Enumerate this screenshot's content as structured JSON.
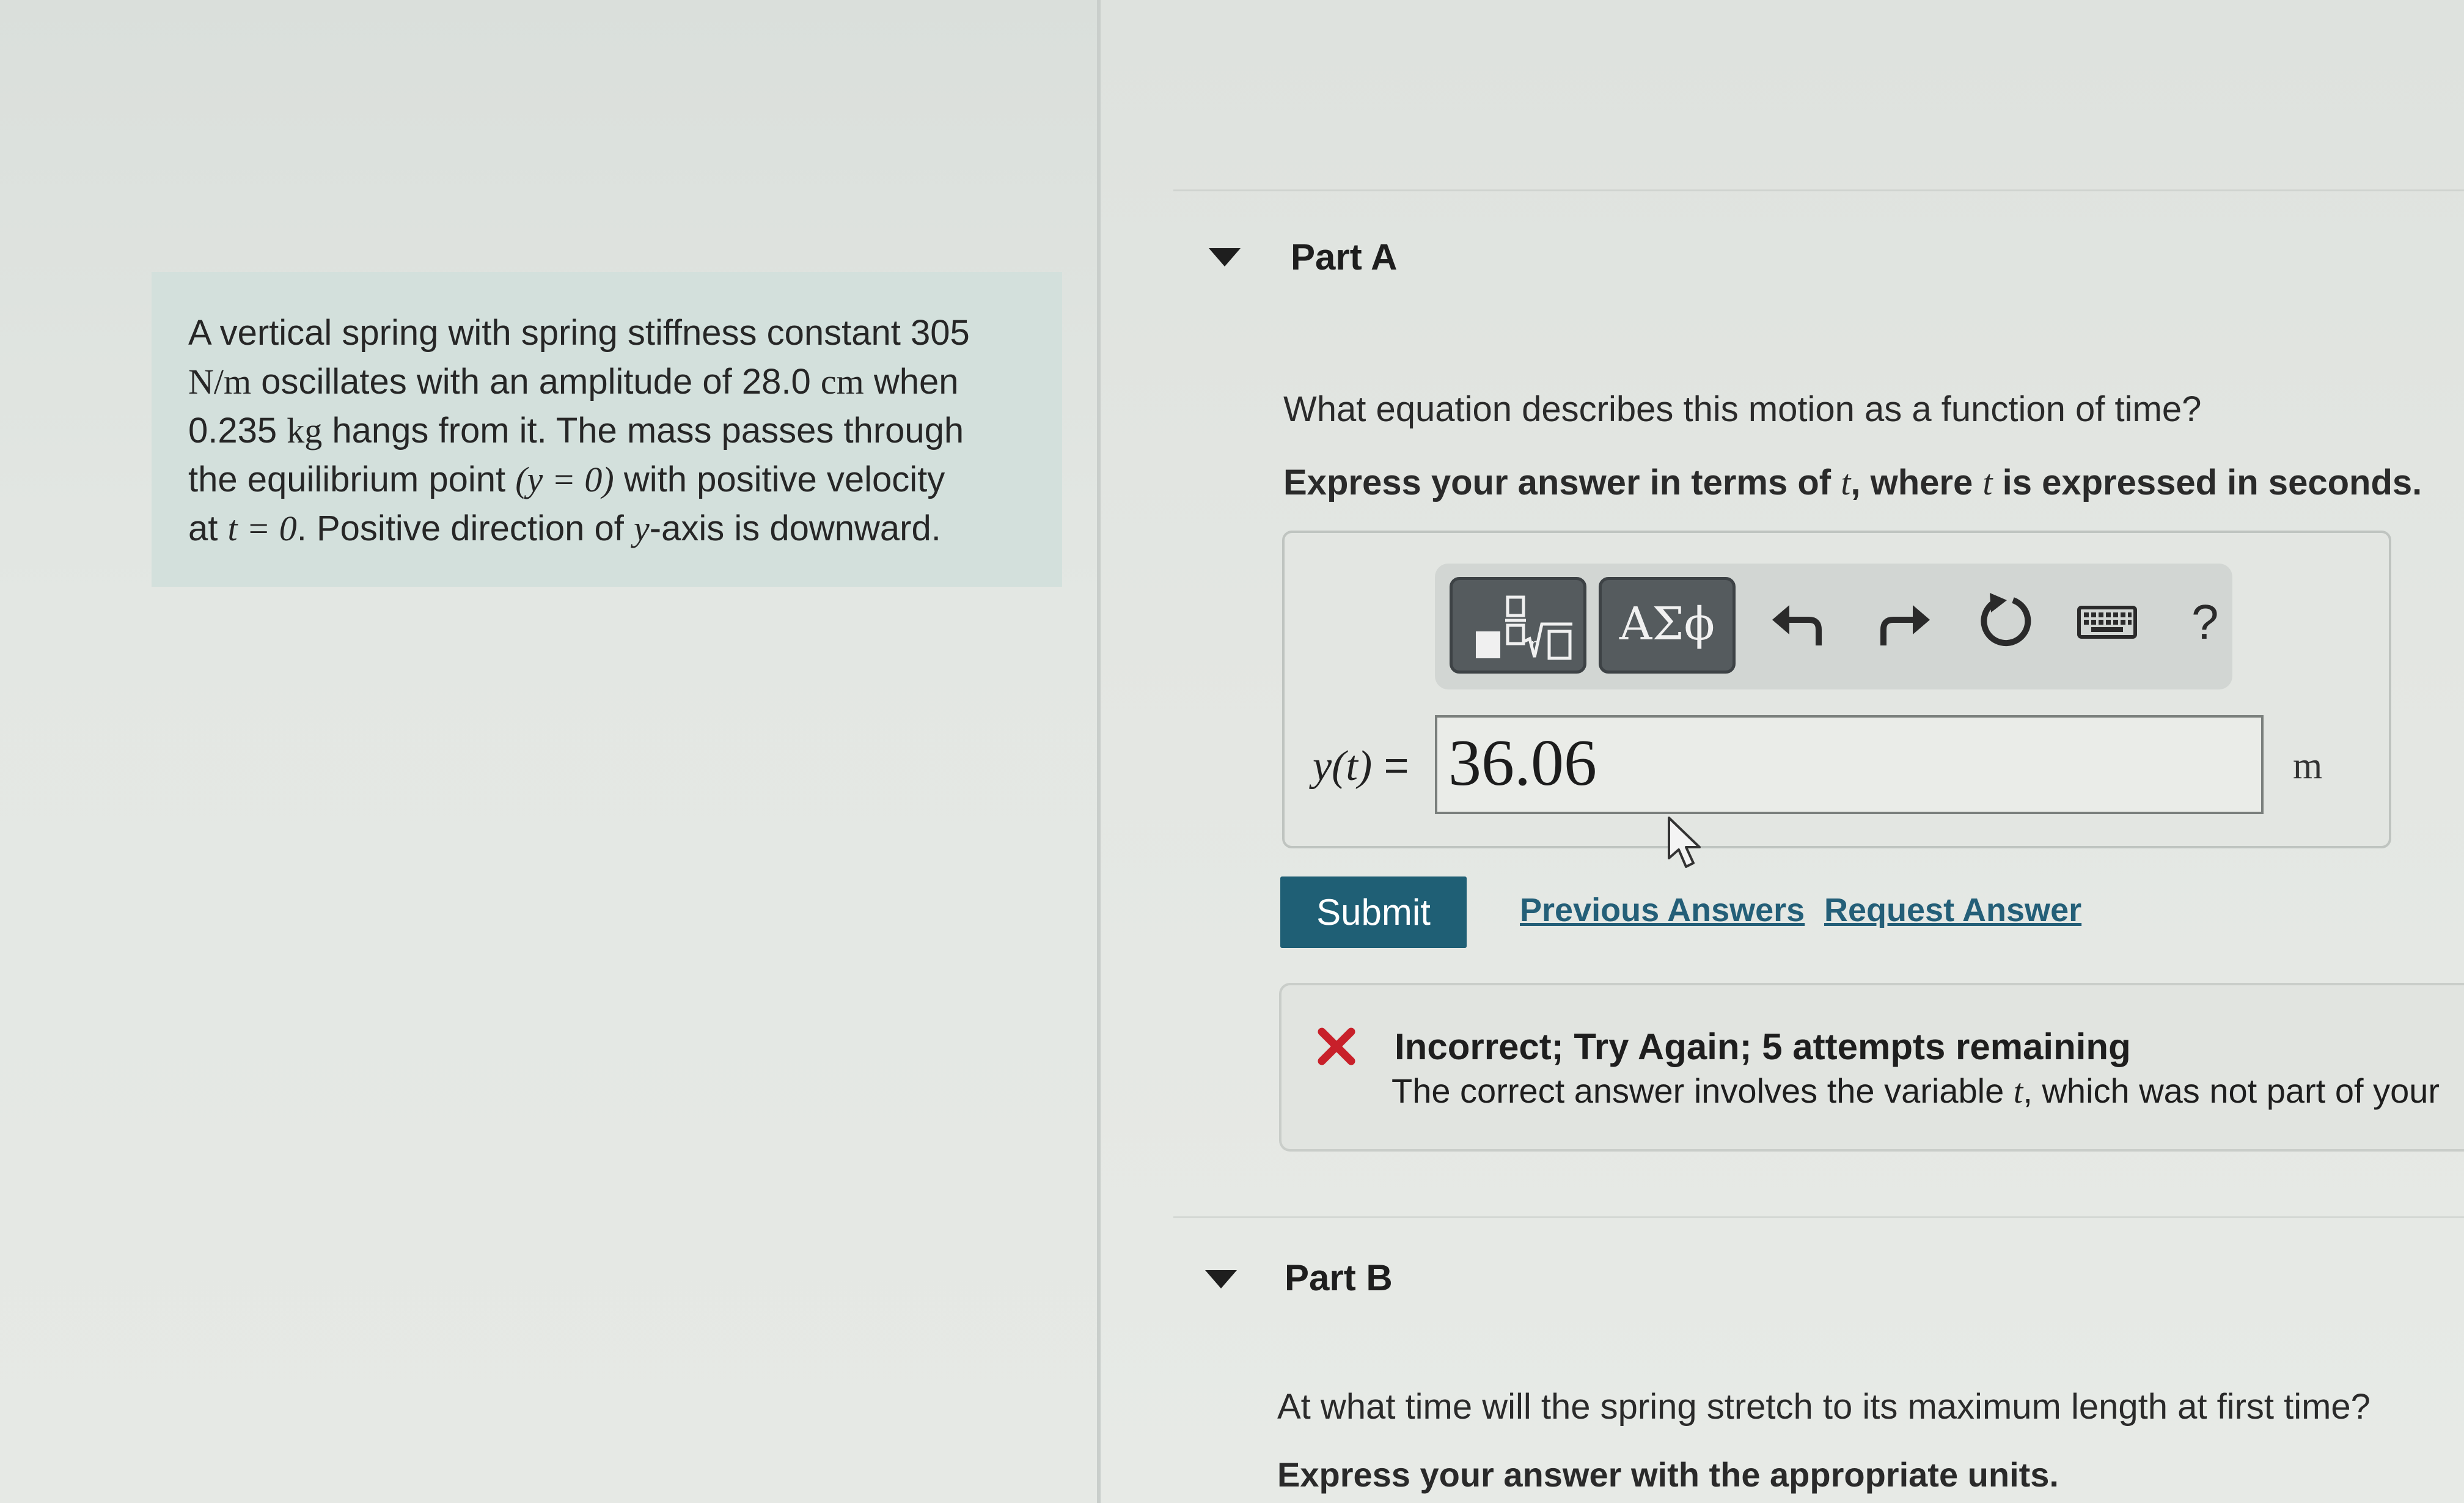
{
  "problem": {
    "line1": "A vertical spring with spring stiffness constant 305",
    "line2_unit": "N/m",
    "line2_rest": " oscillates with an amplitude of 28.0 ",
    "line2_unit2": "cm",
    "line2_end": " when",
    "line3_value": "0.235 ",
    "line3_unit": "kg",
    "line3_rest": " hangs from it. The mass passes through",
    "line4_pre": "the equilibrium point ",
    "line4_math": "(y = 0)",
    "line4_post": " with positive velocity",
    "line5_pre": "at ",
    "line5_math": "t = 0",
    "line5_post": ". Positive direction of ",
    "line5_var": "y",
    "line5_end": "-axis is downward."
  },
  "part_a": {
    "title": "Part A",
    "question": "What equation describes this motion as a function of time?",
    "instruction_pre": "Express your answer in terms of ",
    "instruction_var1": "t",
    "instruction_mid": ", where ",
    "instruction_var2": "t",
    "instruction_post": " is expressed in seconds.",
    "toolbar": {
      "symbols_label": "ΑΣϕ",
      "help_label": "?"
    },
    "answer_label_var": "y(t)",
    "answer_label_eq": " = ",
    "answer_value": "36.06",
    "unit": "m",
    "submit_label": "Submit",
    "previous_answers_label": "Previous Answers",
    "request_answer_label": "Request Answer",
    "feedback": {
      "title": "Incorrect; Try Again; 5 attempts remaining",
      "detail_pre": "The correct answer involves the variable ",
      "detail_var": "t",
      "detail_post": ", which was not part of your"
    }
  },
  "part_b": {
    "title": "Part B",
    "question": "At what time will the spring stretch to its maximum length at first time?",
    "instruction": "Express your answer with the appropriate units."
  },
  "colors": {
    "submit": "#1f5f75",
    "link": "#245f78",
    "error": "#c8202a"
  }
}
